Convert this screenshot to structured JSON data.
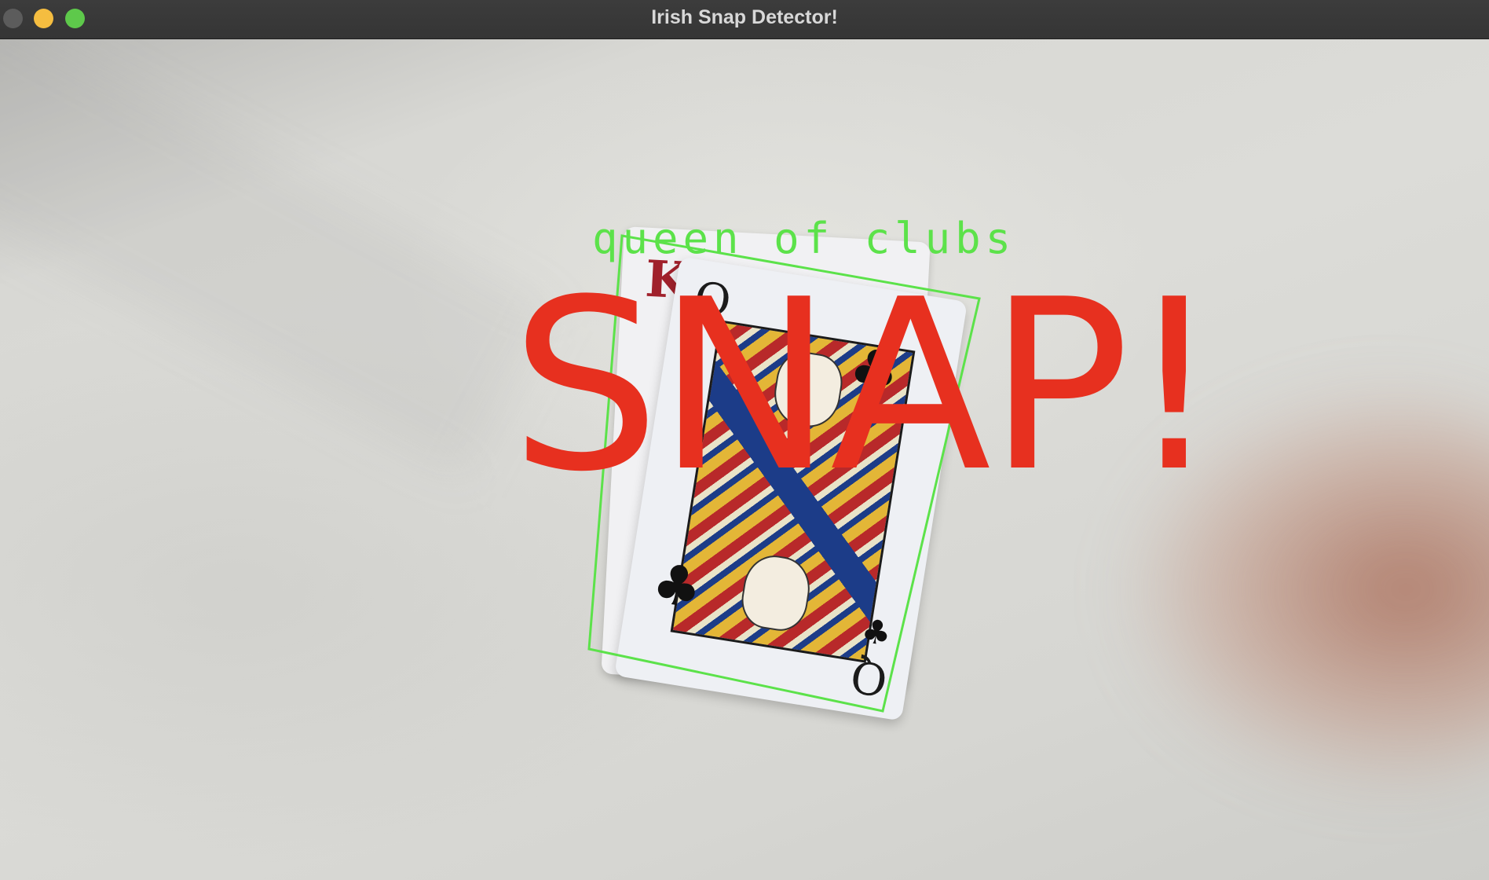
{
  "window": {
    "title": "Irish Snap Detector!"
  },
  "camera": {
    "detection_label": "queen of clubs",
    "snap_text": "SNAP!",
    "overlay_colors": {
      "detection": "#5ce24a",
      "snap": "#e7301f"
    }
  },
  "cards": {
    "back_card_rank": "K",
    "front_card_rank": "Q",
    "front_card_suit": "♣"
  }
}
